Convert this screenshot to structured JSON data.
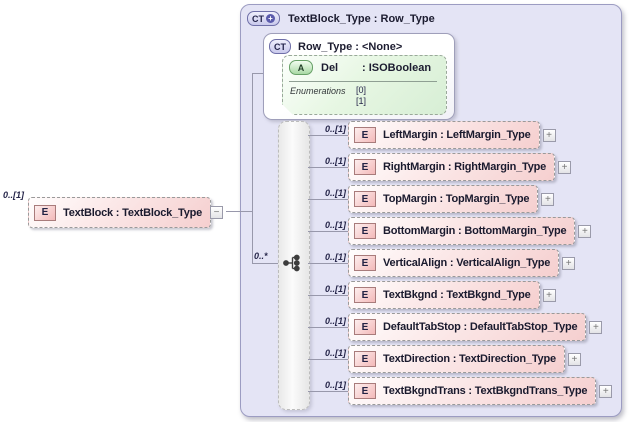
{
  "icons": {
    "plus": "+",
    "minus": "−",
    "ct_plus": "+"
  },
  "root_element": {
    "occurrence": "0..[1]",
    "badge": "E",
    "label": "TextBlock : TextBlock_Type"
  },
  "container": {
    "badge": "CT",
    "title": "TextBlock_Type : Row_Type",
    "base": {
      "badge": "CT",
      "title": "Row_Type : <None>",
      "attribute": {
        "badge": "A",
        "name": "Del",
        "type": ": ISOBoolean",
        "enumerations_label": "Enumerations",
        "values": [
          "[0]",
          "[1]"
        ]
      }
    },
    "compositor_occurrence": "0..*",
    "children": [
      {
        "occurrence": "0..[1]",
        "badge": "E",
        "label": "LeftMargin : LeftMargin_Type"
      },
      {
        "occurrence": "0..[1]",
        "badge": "E",
        "label": "RightMargin : RightMargin_Type"
      },
      {
        "occurrence": "0..[1]",
        "badge": "E",
        "label": "TopMargin : TopMargin_Type"
      },
      {
        "occurrence": "0..[1]",
        "badge": "E",
        "label": "BottomMargin : BottomMargin_Type"
      },
      {
        "occurrence": "0..[1]",
        "badge": "E",
        "label": "VerticalAlign : VerticalAlign_Type"
      },
      {
        "occurrence": "0..[1]",
        "badge": "E",
        "label": "TextBkgnd : TextBkgnd_Type"
      },
      {
        "occurrence": "0..[1]",
        "badge": "E",
        "label": "DefaultTabStop : DefaultTabStop_Type"
      },
      {
        "occurrence": "0..[1]",
        "badge": "E",
        "label": "TextDirection : TextDirection_Type"
      },
      {
        "occurrence": "0..[1]",
        "badge": "E",
        "label": "TextBkgndTrans : TextBkgndTrans_Type"
      }
    ]
  },
  "colors": {
    "container_fill": "#e4e4f5",
    "container_border": "#9c9cc2",
    "element_fill": "#f5cfcf",
    "element_badge_border": "#a87b7b",
    "attribute_fill": "#d7eed5",
    "attribute_badge_border": "#67a067",
    "connector_line": "#9898ab",
    "occurrence_text": "#26264a"
  }
}
